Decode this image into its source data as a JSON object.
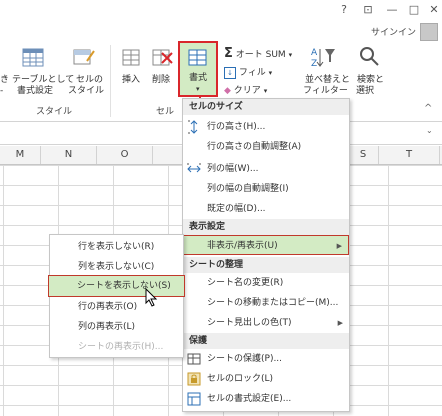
{
  "titlebar": {
    "help": "?",
    "restore": "⊡",
    "minimize": "—",
    "maximize": "□",
    "close": "✕"
  },
  "account": {
    "signin": "サインイン"
  },
  "ribbon": {
    "format_table_top": "テーブルとして",
    "format_table_bottom": "書式設定",
    "format_prefix_top": "き",
    "format_prefix_bottom": "-",
    "cell_style_top": "セルの",
    "cell_style_bottom": "スタイル",
    "group_style": "スタイル",
    "insert": "挿入",
    "delete": "削除",
    "format": "書式",
    "group_cells": "セル",
    "autosum": "オート SUM",
    "fill": "フィル",
    "clear": "クリア",
    "sort_top": "並べ替えと",
    "sort_bottom": "フィルター",
    "find_top": "検索と",
    "find_bottom": "選択",
    "up_arrow": "^"
  },
  "columns": [
    "M",
    "N",
    "O",
    "S",
    "T"
  ],
  "format_menu": {
    "sec_cell_size": "セルのサイズ",
    "row_height": "行の高さ(H)...",
    "row_autofit": "行の高さの自動調整(A)",
    "col_width": "列の幅(W)...",
    "col_autofit": "列の幅の自動調整(I)",
    "default_width": "既定の幅(D)...",
    "sec_visibility": "表示設定",
    "hide_unhide": "非表示/再表示(U)",
    "sec_organize": "シートの整理",
    "rename_sheet": "シート名の変更(R)",
    "move_copy": "シートの移動またはコピー(M)...",
    "tab_color": "シート見出しの色(T)",
    "sec_protection": "保護",
    "protect_sheet": "シートの保護(P)...",
    "lock_cell": "セルのロック(L)",
    "format_cells": "セルの書式設定(E)..."
  },
  "sub_menu": {
    "hide_rows": "行を表示しない(R)",
    "hide_cols": "列を表示しない(C)",
    "hide_sheet": "シートを表示しない(S)",
    "unhide_rows": "行の再表示(O)",
    "unhide_cols": "列の再表示(L)",
    "unhide_sheet": "シートの再表示(H)..."
  },
  "colors": {
    "highlight": "#d3ebc4",
    "accent_red": "#d9262b",
    "excel_green": "#217346"
  }
}
